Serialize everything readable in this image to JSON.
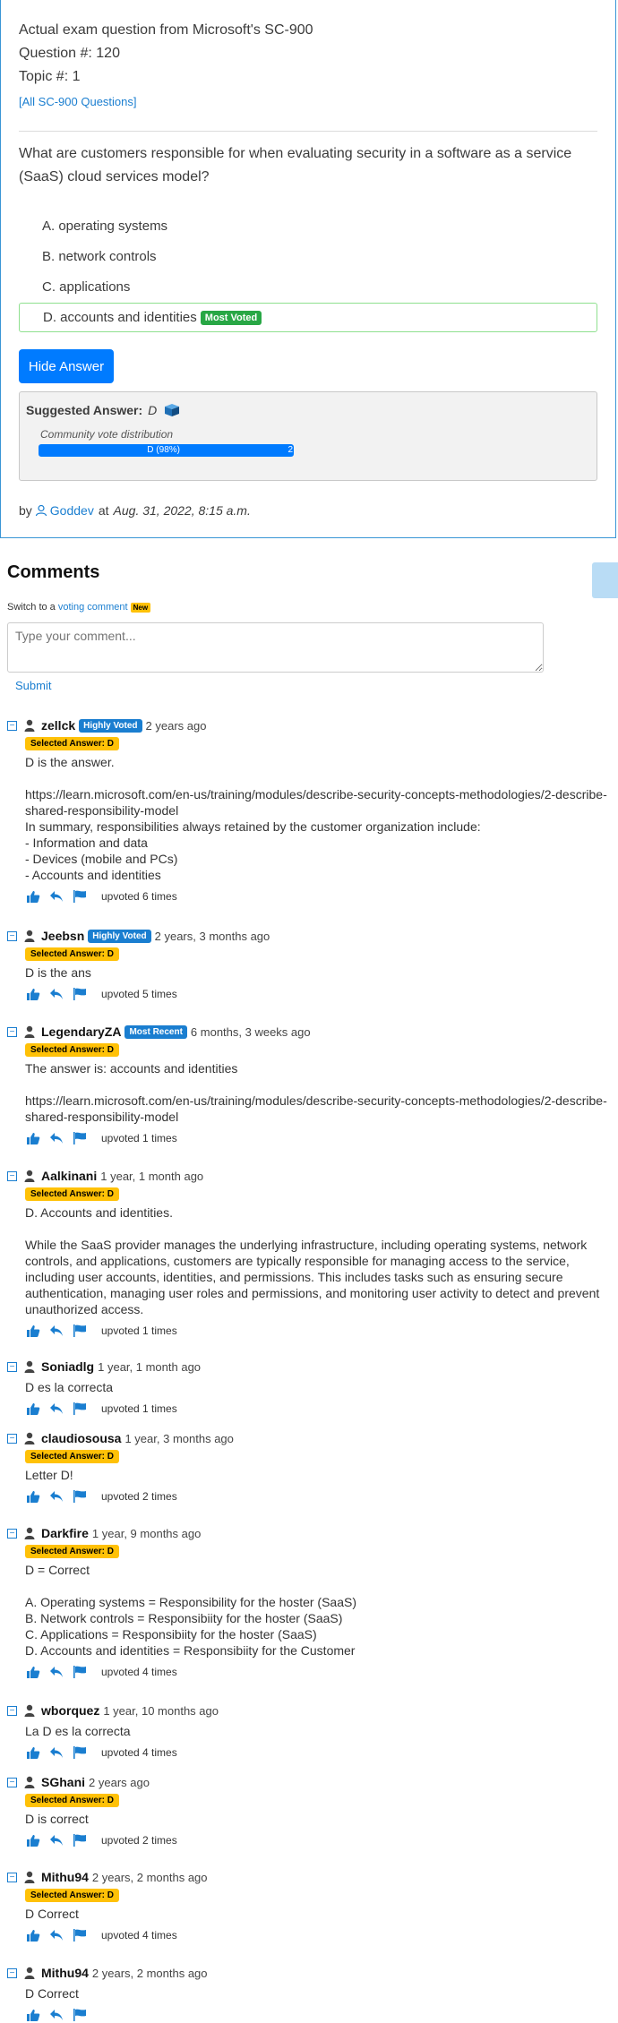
{
  "question": {
    "exam_line": "Actual exam question from Microsoft's SC-900",
    "number_line": "Question #: 120",
    "topic_line": "Topic #: 1",
    "all_link": "[All SC-900 Questions]",
    "text": "What are customers responsible for when evaluating security in a software as a service (SaaS) cloud services model?",
    "choices": [
      {
        "label": "A. operating systems"
      },
      {
        "label": "B. network controls"
      },
      {
        "label": "C. applications"
      },
      {
        "label": "D. accounts and identities",
        "badge": "Most Voted"
      }
    ],
    "hide_button": "Hide Answer",
    "suggested_label": "Suggested Answer:",
    "suggested_value": "D",
    "distribution_label": "Community vote distribution",
    "bar_label": "D (98%)",
    "bar_remainder": "2",
    "bar_fraction": 0.98,
    "by": "by",
    "author": "Goddev",
    "at": "at",
    "date": "Aug. 31, 2022, 8:15 a.m."
  },
  "comments_section": {
    "title": "Comments",
    "switch_prefix": "Switch to a",
    "switch_link": "voting comment",
    "new_badge": "New",
    "placeholder": "Type your comment...",
    "submit": "Submit"
  },
  "comments": [
    {
      "user": "zellck",
      "badge": "Highly Voted",
      "ago": "2 years ago",
      "selected": "Selected Answer: D",
      "text": "D is the answer.\n\nhttps://learn.microsoft.com/en-us/training/modules/describe-security-concepts-methodologies/2-describe-shared-responsibility-model\nIn summary, responsibilities always retained by the customer organization include:\n- Information and data\n- Devices (mobile and PCs)\n- Accounts and identities",
      "upvoted": "upvoted 6 times"
    },
    {
      "user": "Jeebsn",
      "badge": "Highly Voted",
      "ago": "2 years, 3 months ago",
      "selected": "Selected Answer: D",
      "text": "D is the ans",
      "upvoted": "upvoted 5 times"
    },
    {
      "user": "LegendaryZA",
      "badge": "Most Recent",
      "ago": "6 months, 3 weeks ago",
      "selected": "Selected Answer: D",
      "text": "The answer is: accounts and identities\n\nhttps://learn.microsoft.com/en-us/training/modules/describe-security-concepts-methodologies/2-describe-shared-responsibility-model",
      "upvoted": "upvoted 1 times"
    },
    {
      "user": "Aalkinani",
      "badge": "",
      "ago": "1 year, 1 month ago",
      "selected": "Selected Answer: D",
      "text": "D. Accounts and identities.\n\nWhile the SaaS provider manages the underlying infrastructure, including operating systems, network controls, and applications, customers are typically responsible for managing access to the service, including user accounts, identities, and permissions. This includes tasks such as ensuring secure authentication, managing user roles and permissions, and monitoring user activity to detect and prevent unauthorized access.",
      "upvoted": "upvoted 1 times"
    },
    {
      "user": "Soniadlg",
      "badge": "",
      "ago": "1 year, 1 month ago",
      "selected": "",
      "text": "D es la correcta",
      "upvoted": "upvoted 1 times"
    },
    {
      "user": "claudiosousa",
      "badge": "",
      "ago": "1 year, 3 months ago",
      "selected": "Selected Answer: D",
      "text": "Letter D!",
      "upvoted": "upvoted 2 times"
    },
    {
      "user": "Darkfire",
      "badge": "",
      "ago": "1 year, 9 months ago",
      "selected": "Selected Answer: D",
      "text": "D = Correct\n\nA. Operating systems = Responsibility for the hoster (SaaS)\nB. Network controls = Responsibiity for the hoster (SaaS)\nC. Applications = Responsibiity for the hoster (SaaS)\nD. Accounts and identities = Responsibiity for the Customer",
      "upvoted": "upvoted 4 times"
    },
    {
      "user": "wborquez",
      "badge": "",
      "ago": "1 year, 10 months ago",
      "selected": "",
      "text": "La D es la correcta",
      "upvoted": "upvoted 4 times"
    },
    {
      "user": "SGhani",
      "badge": "",
      "ago": "2 years ago",
      "selected": "Selected Answer: D",
      "text": "D is correct",
      "upvoted": "upvoted 2 times"
    },
    {
      "user": "Mithu94",
      "badge": "",
      "ago": "2 years, 2 months ago",
      "selected": "Selected Answer: D",
      "text": "D Correct",
      "upvoted": "upvoted 4 times"
    },
    {
      "user": "Mithu94",
      "badge": "",
      "ago": "2 years, 2 months ago",
      "selected": "",
      "text": "D Correct",
      "upvoted": ""
    }
  ]
}
